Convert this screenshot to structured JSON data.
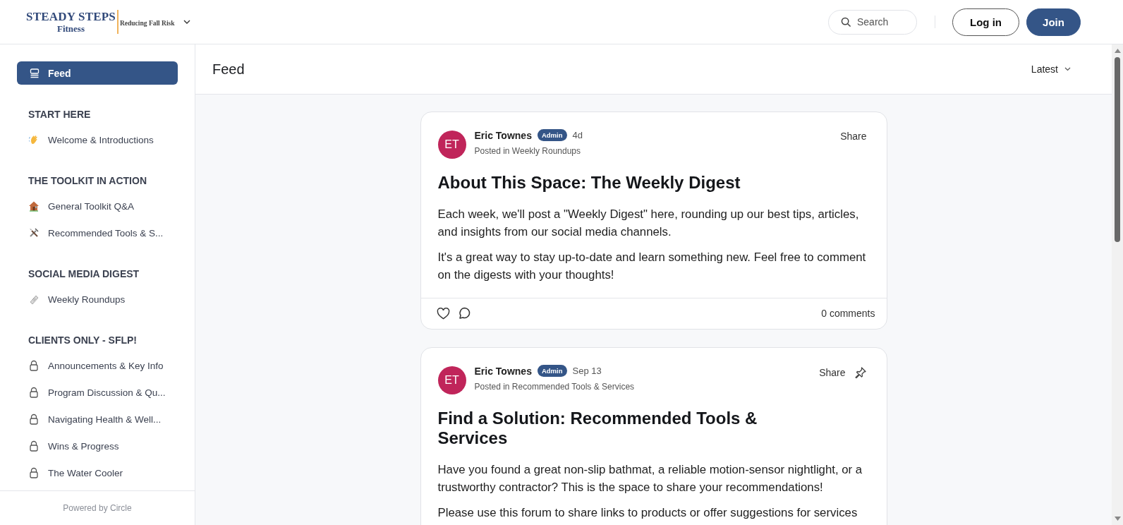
{
  "brand": {
    "name": "STEADY STEPS",
    "subname": "Fitness",
    "tagline": "Reducing Fall Risk"
  },
  "header": {
    "search": {
      "placeholder": "Search"
    },
    "buttons": [
      {
        "label": "Log in",
        "kind": "outline"
      },
      {
        "label": "Join",
        "kind": "primary"
      }
    ]
  },
  "sidebar": {
    "feed": {
      "label": "Feed",
      "selected": true
    },
    "sections": [
      {
        "title": "START HERE",
        "items": [
          {
            "label": "Welcome & Introductions",
            "kind": "wave",
            "selected": false
          }
        ]
      },
      {
        "title": "THE TOOLKIT IN ACTION",
        "items": [
          {
            "label": "General Toolkit Q&A",
            "kind": "house",
            "selected": false
          },
          {
            "label": "Recommended Tools & S...",
            "kind": "tools",
            "selected": false
          }
        ]
      },
      {
        "title": "SOCIAL MEDIA DIGEST",
        "items": [
          {
            "label": "Weekly Roundups",
            "kind": "newspaper",
            "selected": false
          }
        ]
      },
      {
        "title": "CLIENTS ONLY - SFLP!",
        "items": [
          {
            "label": "Announcements & Key Info",
            "kind": "lock",
            "selected": false
          },
          {
            "label": "Program Discussion & Qu...",
            "kind": "lock",
            "selected": false
          },
          {
            "label": "Navigating Health & Well...",
            "kind": "lock",
            "selected": false
          },
          {
            "label": "Wins & Progress",
            "kind": "lock",
            "selected": false
          },
          {
            "label": "The Water Cooler",
            "kind": "lock",
            "selected": false
          }
        ]
      }
    ],
    "footer": "Powered by Circle"
  },
  "page": {
    "title": "Feed",
    "sort": "Latest"
  },
  "posts": [
    {
      "author": "Eric Townes",
      "initials": "ET",
      "badge": "Admin",
      "time": "4d",
      "posted_in": "Posted in Weekly Roundups",
      "share": "Share",
      "pinned": false,
      "title": "About This Space: The Weekly Digest",
      "paragraphs": [
        "Each week, we'll post a \"Weekly Digest\" here, rounding up our best tips, articles, and insights from our social media channels.",
        "It's a great way to stay up-to-date and learn something new. Feel free to comment on the digests with your thoughts!"
      ],
      "comments": "0 comments"
    },
    {
      "author": "Eric Townes",
      "initials": "ET",
      "badge": "Admin",
      "time": "Sep 13",
      "posted_in": "Posted in Recommended Tools & Services",
      "share": "Share",
      "pinned": true,
      "title": "Find a Solution: Recommended Tools & Services",
      "paragraphs": [
        "Have you found a great non-slip bathmat, a reliable motion-sensor nightlight, or a trustworthy contractor? This is the space to share your recommendations!",
        "Please use this forum to share links to products or offer suggestions for services"
      ]
    }
  ]
}
